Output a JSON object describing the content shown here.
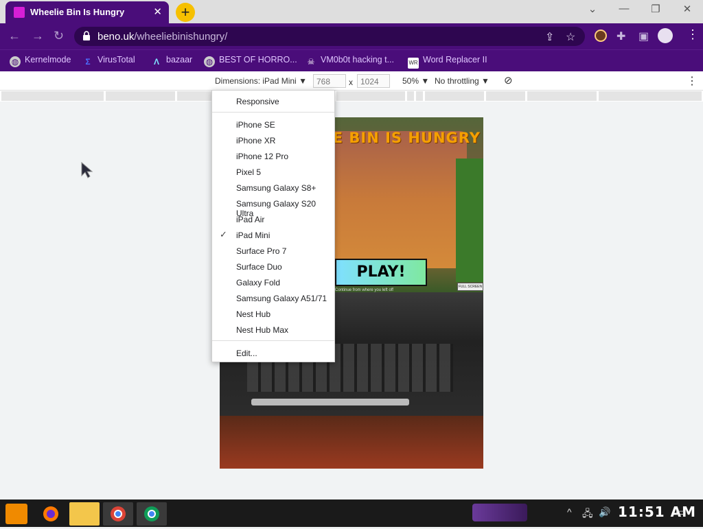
{
  "browser": {
    "tab_title": "Wheelie Bin Is Hungry",
    "url_host": "beno.uk",
    "url_path": "/wheeliebinishungry/"
  },
  "bookmarks": [
    {
      "label": "Kernelmode",
      "icon": "globe-icon"
    },
    {
      "label": "VirusTotal",
      "icon": "virustotal-icon"
    },
    {
      "label": "bazaar",
      "icon": "bazaar-icon"
    },
    {
      "label": "BEST OF HORRO...",
      "icon": "globe-icon"
    },
    {
      "label": "VM0b0t hacking t...",
      "icon": "skull-icon"
    },
    {
      "label": "Word Replacer II",
      "icon": "wr-icon"
    }
  ],
  "devtools": {
    "dimensions_label": "Dimensions: iPad Mini",
    "width_value": "768",
    "height_value": "1024",
    "times": "x",
    "zoom": "50%",
    "throttling": "No throttling"
  },
  "device_menu": {
    "responsive": "Responsive",
    "devices": [
      "iPhone SE",
      "iPhone XR",
      "iPhone 12 Pro",
      "Pixel 5",
      "Samsung Galaxy S8+",
      "Samsung Galaxy S20 Ultra",
      "iPad Air",
      "iPad Mini",
      "Surface Pro 7",
      "Surface Duo",
      "Galaxy Fold",
      "Samsung Galaxy A51/71",
      "Nest Hub",
      "Nest Hub Max"
    ],
    "selected": "iPad Mini",
    "edit": "Edit..."
  },
  "game": {
    "title": "WHEELIE BIN IS HUNGRY",
    "play_label": "PLAY!",
    "fullscreen_label": "FULL SCREEN",
    "continue_text": "Continue from where you left off"
  },
  "taskbar": {
    "clock": "11:51 AM"
  }
}
